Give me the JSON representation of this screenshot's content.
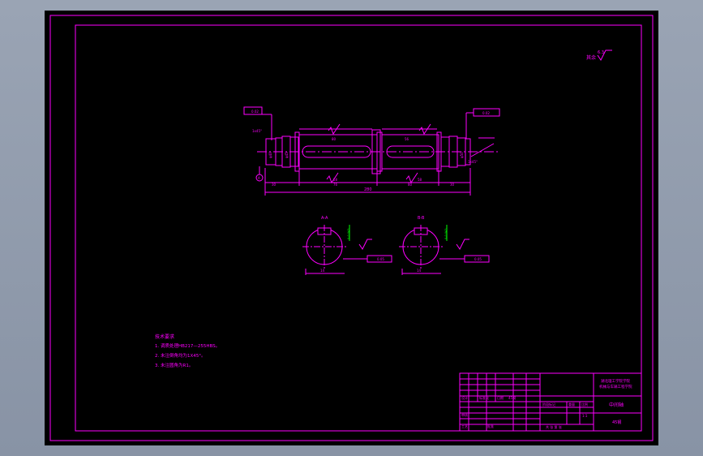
{
  "colors": {
    "background": "#000000",
    "frame": "#ff00ff",
    "geometry": "#ff00ff",
    "centerline": "#ff00ff",
    "highlight": "#00ff00",
    "outer_bg": "#8e99aa"
  },
  "drawing": {
    "roughness_note": "其余",
    "roughness_value": "6.3",
    "section_a_label": "A-A",
    "section_b_label": "B-B",
    "section_a_keyway": "14",
    "section_a_keyway_tol": "0-0.043",
    "section_b_keyway": "14",
    "section_b_keyway_tol": "0-0.043",
    "overall_length": "280",
    "runout_left_box": "0.02",
    "runout_right_box": "0.02",
    "datum_a": "A",
    "datum_b": "B",
    "symmetry_tol_a": "0.05",
    "symmetry_tol_b": "0.05",
    "chamfer_left": "1x45°",
    "chamfer_right": "1x45°",
    "dim_left_1": "30",
    "dim_left_2": "58",
    "dim_mid_1": "76",
    "dim_mid_2": "80",
    "dim_right_1": "30",
    "dim_right_2": "58",
    "keyway_len_1": "80",
    "keyway_len_2": "56",
    "dia_1": "φ40",
    "dia_2": "φ45",
    "dia_3": "φ50"
  },
  "notes": {
    "title": "技术要求",
    "items": [
      "1. 调质处理HB217—255HBS。",
      "2. 未注倒角均为1X45°。",
      "3. 未注圆角为R1。"
    ]
  },
  "title_block": {
    "school_line1": "湖北理工学院学院",
    "school_line2": "机械与车辆工程学院",
    "part_name": "中间轴",
    "material": "45钢",
    "stage_label": "阶段标记",
    "weight_label": "重量",
    "scale_label": "比例",
    "scale": "1:1",
    "sheet_row": "共 张 第 张",
    "designer": "设计",
    "checker": "审核",
    "process": "工艺",
    "standard": "标准化",
    "approve": "批准",
    "date": "日期"
  }
}
